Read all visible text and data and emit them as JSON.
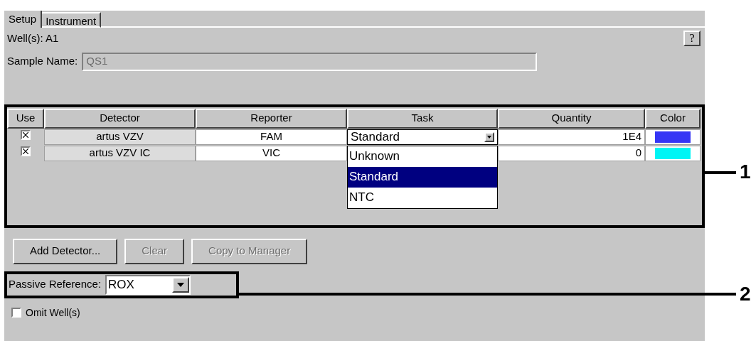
{
  "tabs": [
    {
      "label": "Setup",
      "selected": true
    },
    {
      "label": "Instrument",
      "selected": false
    }
  ],
  "wells": "Well(s): A1",
  "help_button": "?",
  "sample_name": {
    "label": "Sample Name:",
    "value": "QS1",
    "disabled": true
  },
  "table": {
    "columns": [
      "Use",
      "Detector",
      "Reporter",
      "Task",
      "Quantity",
      "Color"
    ],
    "rows": [
      {
        "checked": true,
        "detector": "artus VZV",
        "reporter": "FAM",
        "task": "Standard",
        "quantity": "1E4",
        "color": "#3535f5"
      },
      {
        "checked": true,
        "detector": "artus VZV IC",
        "reporter": "VIC",
        "quantity": "0",
        "color": "#00f5f5"
      }
    ]
  },
  "task_dropdown": [
    {
      "label": "Unknown",
      "selected": false
    },
    {
      "label": "Standard",
      "selected": true
    },
    {
      "label": "NTC",
      "selected": false
    }
  ],
  "buttons": [
    {
      "label": "Add Detector...",
      "disabled": false
    },
    {
      "label": "Clear",
      "disabled": true
    },
    {
      "label": "Copy to Manager",
      "disabled": true
    }
  ],
  "passive_reference": {
    "label": "Passive Reference:",
    "value": "ROX"
  },
  "omit_wells": {
    "label": "Omit Well(s)",
    "checked": false
  },
  "callouts": [
    "1",
    "2"
  ]
}
